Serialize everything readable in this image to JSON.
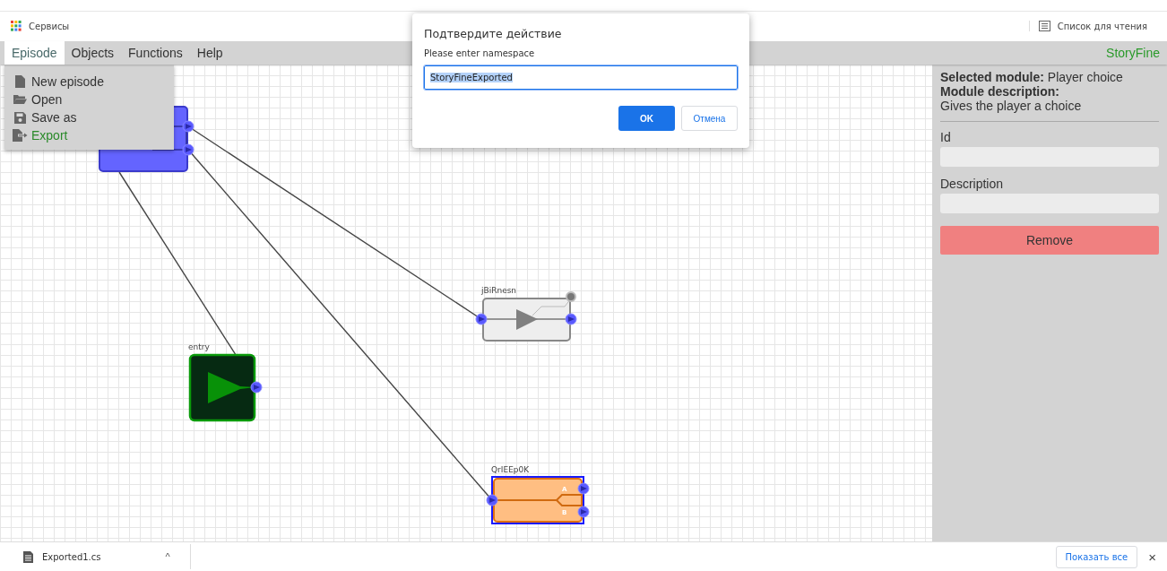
{
  "bookmarks_bar": {
    "apps": "Сервисы",
    "reading_list": "Список для чтения"
  },
  "menu_bar": {
    "items": [
      {
        "label": "Episode",
        "selected": true
      },
      {
        "label": "Objects",
        "selected": false
      },
      {
        "label": "Functions",
        "selected": false
      },
      {
        "label": "Help",
        "selected": false
      }
    ],
    "brand": "StoryFine"
  },
  "episode_menu": [
    {
      "kind": "new",
      "label": "New episode",
      "highlighted": false
    },
    {
      "kind": "open",
      "label": "Open",
      "highlighted": false
    },
    {
      "kind": "save",
      "label": "Save as",
      "highlighted": false
    },
    {
      "kind": "export",
      "label": "Export",
      "highlighted": true
    }
  ],
  "canvas": {
    "nodes": [
      {
        "kind": "start",
        "selected": false
      },
      {
        "kind": "entry",
        "label": "entry",
        "selected": false
      },
      {
        "kind": "relay",
        "label": "jBiRnesn",
        "selected": false
      },
      {
        "kind": "choice",
        "label": "QrIEEp0K",
        "selected": true,
        "outputs": [
          "A",
          "B"
        ]
      }
    ]
  },
  "side_panel": {
    "selected_module": "**Selected module:** Player choice",
    "description_heading": "Module description:",
    "description": "Gives the player a choice",
    "fields": [
      {
        "label": "Id"
      },
      {
        "label": "Description"
      }
    ],
    "remove_button": "Remove"
  },
  "dialog": {
    "title": "Подтвердите действие",
    "message": "Please enter namespace",
    "value": "StoryFineExported",
    "ok": "OK",
    "cancel": "Отмена"
  },
  "download_bar": {
    "file": "Exported1.cs",
    "caret": "^",
    "show_all": "Показать все",
    "close": "×"
  }
}
